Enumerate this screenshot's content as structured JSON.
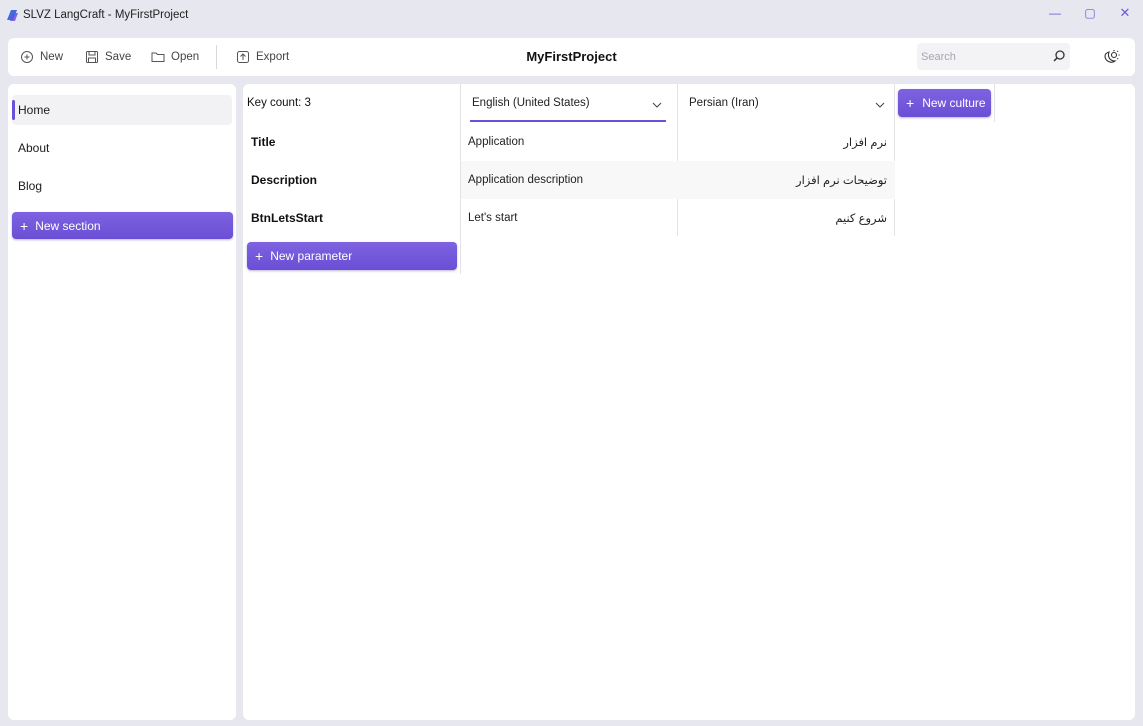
{
  "window": {
    "title": "SLVZ LangCraft - MyFirstProject",
    "controls": {
      "minimize": "—",
      "maximize": "▢",
      "close": "✕"
    }
  },
  "toolbar": {
    "new_label": "New",
    "save_label": "Save",
    "open_label": "Open",
    "export_label": "Export",
    "project_title": "MyFirstProject",
    "search_placeholder": "Search"
  },
  "sidebar": {
    "items": [
      {
        "label": "Home",
        "active": true
      },
      {
        "label": "About",
        "active": false
      },
      {
        "label": "Blog",
        "active": false
      }
    ],
    "new_section_label": "New section"
  },
  "editor": {
    "key_count_label": "Key count: 3",
    "cultures": [
      {
        "label": "English (United States)",
        "selected": true
      },
      {
        "label": "Persian (Iran)",
        "selected": false
      }
    ],
    "new_culture_label": "New culture",
    "rows": [
      {
        "key": "Title",
        "en": "Application",
        "fa": "نرم افزار"
      },
      {
        "key": "Description",
        "en": "Application description",
        "fa": "توضیحات نرم افزار"
      },
      {
        "key": "BtnLetsStart",
        "en": "Let's start",
        "fa": "شروع کنیم"
      }
    ],
    "new_parameter_label": "New parameter"
  },
  "colors": {
    "accent": "#6b51d9",
    "window_bg": "#e6e7ef",
    "panel_bg": "#ffffff"
  },
  "icons": {
    "new": "add-file-icon",
    "save": "save-icon",
    "open": "folder-icon",
    "export": "export-icon",
    "search": "search-icon",
    "theme": "theme-icon"
  }
}
